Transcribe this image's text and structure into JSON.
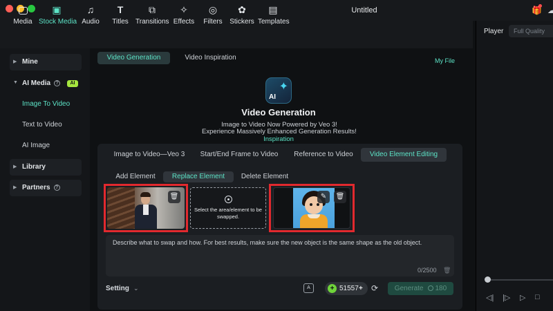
{
  "window": {
    "title": "Untitled"
  },
  "toolbar": {
    "items": [
      {
        "label": "Media",
        "icon": "media-icon"
      },
      {
        "label": "Stock Media",
        "icon": "stock-media-icon"
      },
      {
        "label": "Audio",
        "icon": "headphones-icon"
      },
      {
        "label": "Titles",
        "icon": "titles-icon"
      },
      {
        "label": "Transitions",
        "icon": "transitions-icon"
      },
      {
        "label": "Effects",
        "icon": "effects-icon"
      },
      {
        "label": "Filters",
        "icon": "filters-icon"
      },
      {
        "label": "Stickers",
        "icon": "stickers-icon"
      },
      {
        "label": "Templates",
        "icon": "templates-icon"
      }
    ],
    "active": "Stock Media",
    "accent_color": "#5de4c7"
  },
  "player": {
    "tab": "Player",
    "quality": "Full Quality"
  },
  "sidebar": {
    "mine": "Mine",
    "ai_media": "AI Media",
    "ai_badge": "AI",
    "items": [
      "Image To Video",
      "Text to Video",
      "AI Image"
    ],
    "library": "Library",
    "partners": "Partners"
  },
  "top_tabs": [
    "Video Generation",
    "Video Inspiration"
  ],
  "my_file": "My File",
  "hero": {
    "logo_text": "AI",
    "title": "Video Generation",
    "line1": "Image to Video Now Powered by Veo 3!",
    "line2": "Experience Massively Enhanced Generation Results!",
    "link": "Inspiration"
  },
  "mode_tabs": [
    "Image to Video—Veo 3",
    "Start/End Frame to Video",
    "Reference to Video",
    "Video Element Editing"
  ],
  "sub_tabs": [
    "Add Element",
    "Replace Element",
    "Delete Element"
  ],
  "selector_hint": "Select the area/element to be swapped.",
  "prompt": {
    "placeholder": "Describe what to swap and how. For best results, make sure the new object is the same shape as the old object.",
    "counter": "0/2500"
  },
  "footer": {
    "setting": "Setting",
    "credits": "51557",
    "generate": "Generate",
    "cost": "180"
  },
  "highlight_color": "#e2292e"
}
